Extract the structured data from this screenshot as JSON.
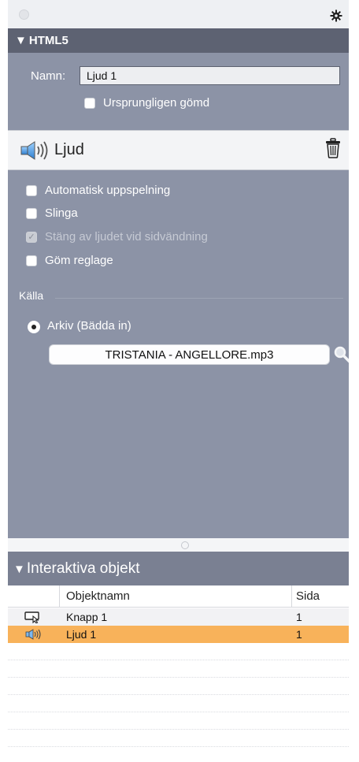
{
  "colors": {
    "panel": "#8c93a6",
    "header": "#5d6272",
    "selection": "#f8b25a"
  },
  "section": {
    "title": "HTML5",
    "collapse_glyph": "▼"
  },
  "name": {
    "label": "Namn:",
    "value": "Ljud 1"
  },
  "initially_hidden": {
    "label": "Ursprungligen gömd",
    "checked": false
  },
  "audio_header": {
    "title": "Ljud",
    "icon": "speaker-icon",
    "delete_icon": "trash-icon"
  },
  "options": [
    {
      "label": "Automatisk uppspelning",
      "checked": false,
      "enabled": true
    },
    {
      "label": "Slinga",
      "checked": false,
      "enabled": true
    },
    {
      "label": "Stäng av ljudet vid sidvändning",
      "checked": true,
      "enabled": false
    },
    {
      "label": "Göm reglage",
      "checked": false,
      "enabled": true
    }
  ],
  "source": {
    "heading": "Källa",
    "radio_label": "Arkiv (Bädda in)",
    "radio_selected": true,
    "file": "TRISTANIA - ANGELLORE.mp3"
  },
  "interactive": {
    "title": "Interaktiva objekt",
    "collapse_glyph": "▼",
    "columns": [
      "Objektnamn",
      "Sida"
    ],
    "rows": [
      {
        "icon": "button-object-icon",
        "name": "Knapp 1",
        "page": "1",
        "selected": false
      },
      {
        "icon": "speaker-icon",
        "name": "Ljud 1",
        "page": "1",
        "selected": true
      }
    ]
  }
}
